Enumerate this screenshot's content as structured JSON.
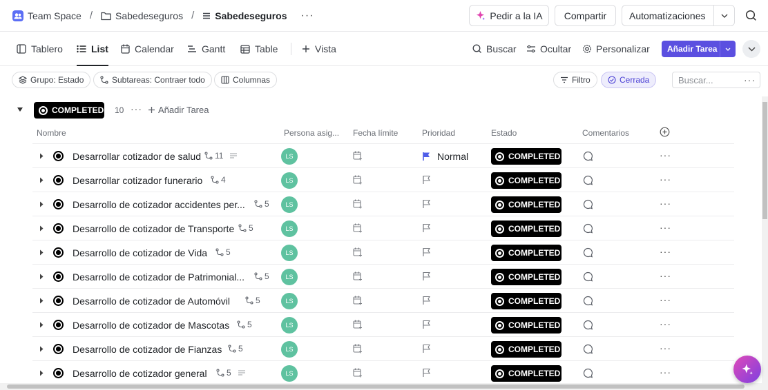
{
  "breadcrumb": {
    "space": "Team Space",
    "folder": "Sabedeseguros",
    "list": "Sabedeseguros"
  },
  "topbar": {
    "ai_label": "Pedir a la IA",
    "share_label": "Compartir",
    "automations_label": "Automatizaciones"
  },
  "views": {
    "tabs": [
      {
        "label": "Tablero",
        "icon": "board-icon"
      },
      {
        "label": "List",
        "icon": "list-icon",
        "active": true
      },
      {
        "label": "Calendar",
        "icon": "calendar-icon"
      },
      {
        "label": "Gantt",
        "icon": "gantt-icon"
      },
      {
        "label": "Table",
        "icon": "table-icon"
      }
    ],
    "add_view_label": "Vista",
    "search_label": "Buscar",
    "hide_label": "Ocultar",
    "customize_label": "Personalizar",
    "add_task_label": "Añadir Tarea"
  },
  "filters": {
    "group_label": "Grupo: Estado",
    "subtasks_label": "Subtareas: Contraer todo",
    "columns_label": "Columnas",
    "filter_label": "Filtro",
    "closed_label": "Cerrada",
    "search_placeholder": "Buscar..."
  },
  "group": {
    "status": "COMPLETED",
    "count": "10",
    "add_task_label": "Añadir Tarea"
  },
  "columns": {
    "name": "Nombre",
    "assignee": "Persona asig...",
    "due_date": "Fecha límite",
    "priority": "Prioridad",
    "status": "Estado",
    "comments": "Comentarios"
  },
  "tasks": [
    {
      "title": "Desarrollar cotizador de salud",
      "subtasks": "11",
      "has_description": true,
      "assignee": "LS",
      "priority": "Normal",
      "status": "COMPLETED"
    },
    {
      "title": "Desarrollar cotizador funerario",
      "subtasks": "4",
      "has_description": false,
      "assignee": "LS",
      "priority": "",
      "status": "COMPLETED"
    },
    {
      "title": "Desarrollo de cotizador accidentes per...",
      "subtasks": "5",
      "has_description": false,
      "assignee": "LS",
      "priority": "",
      "status": "COMPLETED"
    },
    {
      "title": "Desarrollo de cotizador de Transporte",
      "subtasks": "5",
      "has_description": false,
      "assignee": "LS",
      "priority": "",
      "status": "COMPLETED"
    },
    {
      "title": "Desarrollo de cotizador de Vida",
      "subtasks": "5",
      "has_description": false,
      "assignee": "LS",
      "priority": "",
      "status": "COMPLETED"
    },
    {
      "title": "Desarrollo de cotizador de Patrimonial...",
      "subtasks": "5",
      "has_description": false,
      "assignee": "LS",
      "priority": "",
      "status": "COMPLETED"
    },
    {
      "title": "Desarrollo de cotizador de Automóvil",
      "subtasks": "5",
      "has_description": false,
      "assignee": "LS",
      "priority": "",
      "status": "COMPLETED"
    },
    {
      "title": "Desarrollo de cotizador de Mascotas",
      "subtasks": "5",
      "has_description": false,
      "assignee": "LS",
      "priority": "",
      "status": "COMPLETED"
    },
    {
      "title": "Desarrollo de cotizador de Fianzas",
      "subtasks": "5",
      "has_description": false,
      "assignee": "LS",
      "priority": "",
      "status": "COMPLETED"
    },
    {
      "title": "Desarrollo de cotizador general",
      "subtasks": "5",
      "has_description": true,
      "assignee": "LS",
      "priority": "",
      "status": "COMPLETED"
    }
  ],
  "colors": {
    "accent": "#5b4fe0",
    "avatar": "#5fc2a0",
    "status_completed": "#000000",
    "priority_normal": "#4f5ee8"
  }
}
